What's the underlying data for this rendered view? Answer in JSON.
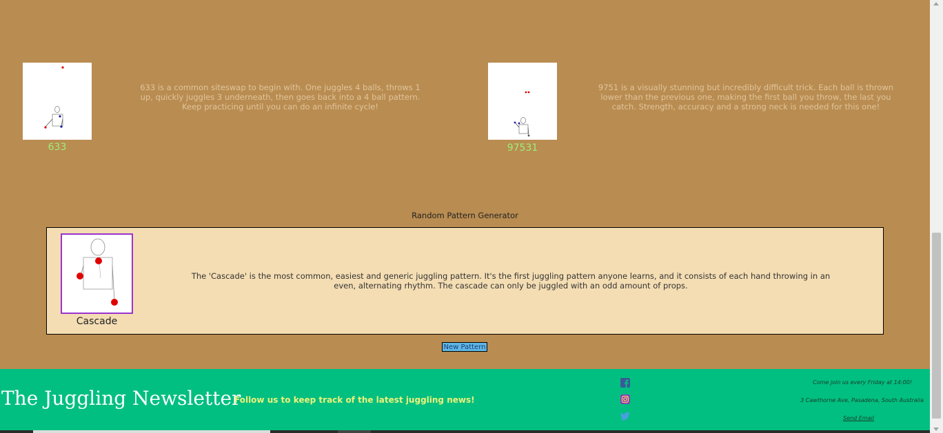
{
  "patterns": [
    {
      "name": "633",
      "description": "633 is a common siteswap to begin with. One juggles 4 balls, throws 1 up, quickly juggles 3 underneath, then goes back into a 4 ball pattern. Keep practicing until you can do an infinite cycle!"
    },
    {
      "name": "97531",
      "description": "9751 is a visually stunning but incredibly difficult trick. Each ball is thrown lower than the previous one, making the first ball you throw, the last you catch. Strength, accuracy and a strong neck is needed for this one!"
    }
  ],
  "generator": {
    "title": "Random Pattern Generator",
    "pattern_name": "Cascade",
    "description": "The 'Cascade' is the most common, easiest and generic juggling pattern. It's the first juggling pattern anyone learns, and it consists of each hand throwing in an even, alternating rhythm. The cascade can only be juggled with an odd amount of props.",
    "button_label": "New Pattern"
  },
  "footer": {
    "title": "The Juggling Newsletter",
    "tagline": "Follow us to keep track of the latest juggling news!",
    "social_icons": [
      "facebook-icon",
      "instagram-icon",
      "twitter-icon"
    ],
    "meeting": "Come join us every Friday at 14:00!",
    "address": "3 Cawthorne Ave, Pasadena, South Australia",
    "email_link": "Send Email"
  },
  "colors": {
    "page_background": "#b98c51",
    "footer_background": "#01bf80",
    "pattern_caption": "#9df07a",
    "generator_panel": "#f4ddb3",
    "generator_border": "#9a32cd",
    "button": "#5fb7e4",
    "ball_red": "#e00000",
    "ball_blue": "#1a1aa0"
  }
}
